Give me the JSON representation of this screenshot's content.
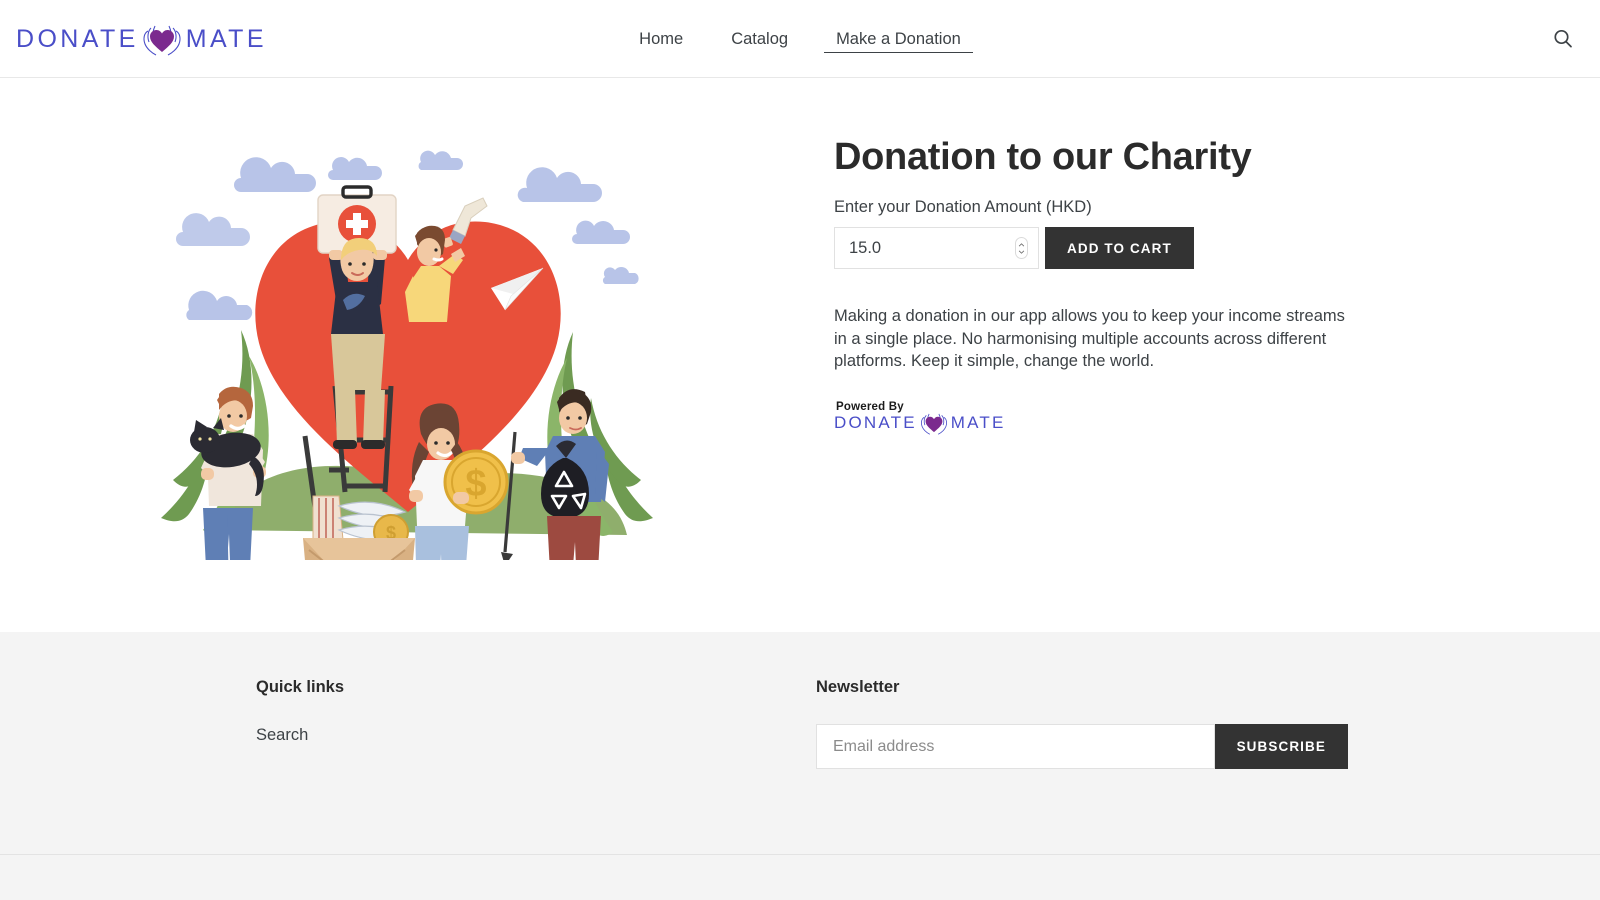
{
  "header": {
    "logo": {
      "text_left": "DONATE",
      "text_right": "MATE",
      "icon": "heart-in-hands-icon",
      "color_text": "#4a4ec8",
      "color_heart": "#7b2a8e"
    },
    "nav": [
      {
        "label": "Home",
        "active": false
      },
      {
        "label": "Catalog",
        "active": false
      },
      {
        "label": "Make a Donation",
        "active": true
      }
    ],
    "search_icon": "search-icon"
  },
  "product": {
    "title": "Donation to our Charity",
    "amount_label": "Enter your Donation Amount (HKD)",
    "amount_value": "15.0",
    "add_to_cart_label": "ADD TO CART",
    "description": "Making a donation in our app allows you to keep your income streams in a single place. No harmonising multiple accounts across different platforms. Keep it simple, change the world.",
    "powered_by": {
      "prefix": "Powered By",
      "text_left": "DONATE",
      "text_right": "MATE"
    }
  },
  "illustration": {
    "alt": "charity volunteers around a large red heart",
    "colors": {
      "heart": "#e8503a",
      "grass": "#8fae6c",
      "fern": "#7ea05a",
      "cloud": "#b8c4e8",
      "coin": "#f0c04a",
      "box": "#d9b183"
    }
  },
  "footer": {
    "quick_links": {
      "heading": "Quick links",
      "items": [
        {
          "label": "Search"
        }
      ]
    },
    "newsletter": {
      "heading": "Newsletter",
      "email_placeholder": "Email address",
      "email_value": "",
      "subscribe_label": "SUBSCRIBE"
    }
  }
}
